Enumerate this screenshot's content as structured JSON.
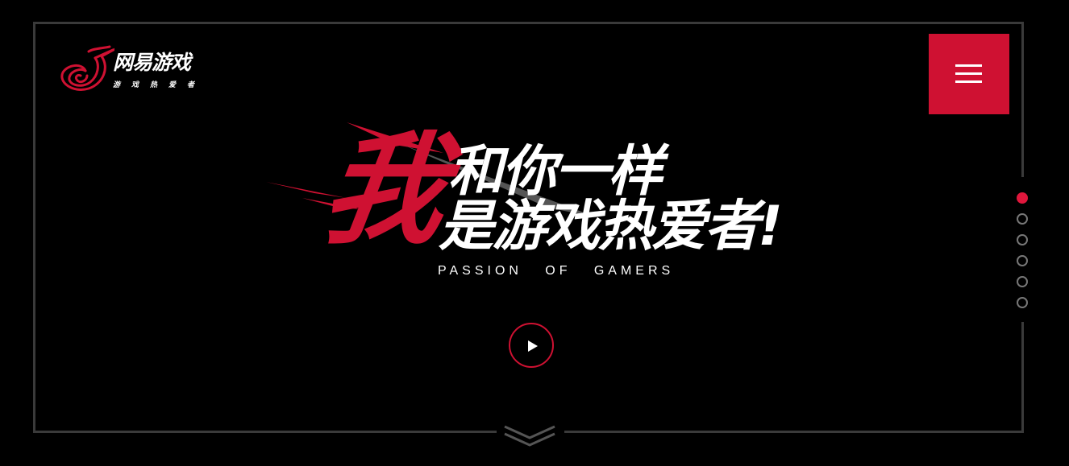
{
  "logo": {
    "name": "网易游戏",
    "tagline": "游戏热爱者",
    "icon": "netease-swirl-logo",
    "brand_color": "#cf1132"
  },
  "menu": {
    "icon": "hamburger-menu-icon",
    "color": "#cf1132"
  },
  "hero": {
    "big_char": "我",
    "line1": "和你一样",
    "line2": "是游戏热爱者!",
    "subtitle": "PASSION   OF   GAMERS",
    "accent": "#cf1132"
  },
  "play": {
    "icon": "play-icon"
  },
  "pagination": {
    "count": 6,
    "active_index": 0
  },
  "scroll": {
    "icon": "chevron-down-icon"
  }
}
